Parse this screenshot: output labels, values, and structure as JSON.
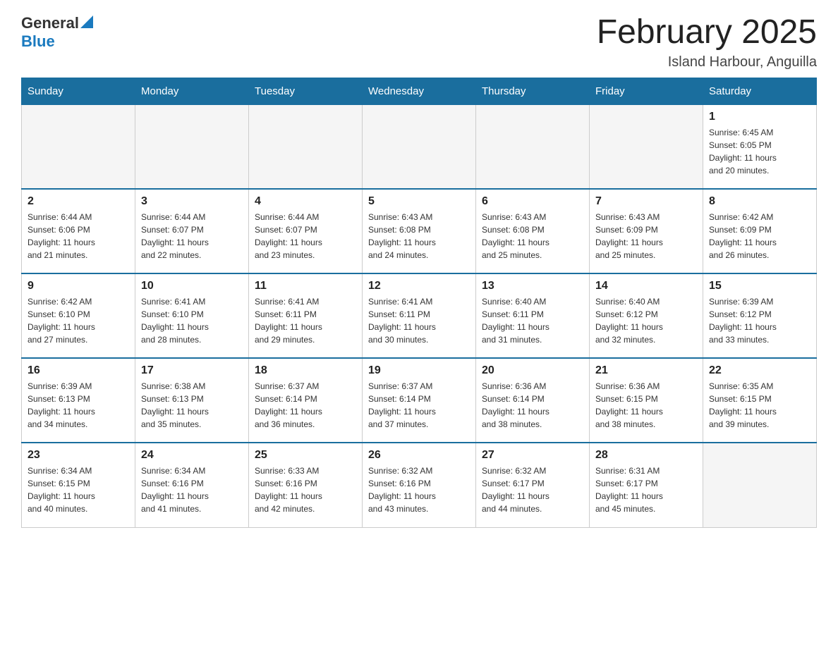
{
  "header": {
    "logo_general": "General",
    "logo_blue": "Blue",
    "month_title": "February 2025",
    "location": "Island Harbour, Anguilla"
  },
  "days_of_week": [
    "Sunday",
    "Monday",
    "Tuesday",
    "Wednesday",
    "Thursday",
    "Friday",
    "Saturday"
  ],
  "weeks": [
    [
      {
        "day": "",
        "info": ""
      },
      {
        "day": "",
        "info": ""
      },
      {
        "day": "",
        "info": ""
      },
      {
        "day": "",
        "info": ""
      },
      {
        "day": "",
        "info": ""
      },
      {
        "day": "",
        "info": ""
      },
      {
        "day": "1",
        "info": "Sunrise: 6:45 AM\nSunset: 6:05 PM\nDaylight: 11 hours\nand 20 minutes."
      }
    ],
    [
      {
        "day": "2",
        "info": "Sunrise: 6:44 AM\nSunset: 6:06 PM\nDaylight: 11 hours\nand 21 minutes."
      },
      {
        "day": "3",
        "info": "Sunrise: 6:44 AM\nSunset: 6:07 PM\nDaylight: 11 hours\nand 22 minutes."
      },
      {
        "day": "4",
        "info": "Sunrise: 6:44 AM\nSunset: 6:07 PM\nDaylight: 11 hours\nand 23 minutes."
      },
      {
        "day": "5",
        "info": "Sunrise: 6:43 AM\nSunset: 6:08 PM\nDaylight: 11 hours\nand 24 minutes."
      },
      {
        "day": "6",
        "info": "Sunrise: 6:43 AM\nSunset: 6:08 PM\nDaylight: 11 hours\nand 25 minutes."
      },
      {
        "day": "7",
        "info": "Sunrise: 6:43 AM\nSunset: 6:09 PM\nDaylight: 11 hours\nand 25 minutes."
      },
      {
        "day": "8",
        "info": "Sunrise: 6:42 AM\nSunset: 6:09 PM\nDaylight: 11 hours\nand 26 minutes."
      }
    ],
    [
      {
        "day": "9",
        "info": "Sunrise: 6:42 AM\nSunset: 6:10 PM\nDaylight: 11 hours\nand 27 minutes."
      },
      {
        "day": "10",
        "info": "Sunrise: 6:41 AM\nSunset: 6:10 PM\nDaylight: 11 hours\nand 28 minutes."
      },
      {
        "day": "11",
        "info": "Sunrise: 6:41 AM\nSunset: 6:11 PM\nDaylight: 11 hours\nand 29 minutes."
      },
      {
        "day": "12",
        "info": "Sunrise: 6:41 AM\nSunset: 6:11 PM\nDaylight: 11 hours\nand 30 minutes."
      },
      {
        "day": "13",
        "info": "Sunrise: 6:40 AM\nSunset: 6:11 PM\nDaylight: 11 hours\nand 31 minutes."
      },
      {
        "day": "14",
        "info": "Sunrise: 6:40 AM\nSunset: 6:12 PM\nDaylight: 11 hours\nand 32 minutes."
      },
      {
        "day": "15",
        "info": "Sunrise: 6:39 AM\nSunset: 6:12 PM\nDaylight: 11 hours\nand 33 minutes."
      }
    ],
    [
      {
        "day": "16",
        "info": "Sunrise: 6:39 AM\nSunset: 6:13 PM\nDaylight: 11 hours\nand 34 minutes."
      },
      {
        "day": "17",
        "info": "Sunrise: 6:38 AM\nSunset: 6:13 PM\nDaylight: 11 hours\nand 35 minutes."
      },
      {
        "day": "18",
        "info": "Sunrise: 6:37 AM\nSunset: 6:14 PM\nDaylight: 11 hours\nand 36 minutes."
      },
      {
        "day": "19",
        "info": "Sunrise: 6:37 AM\nSunset: 6:14 PM\nDaylight: 11 hours\nand 37 minutes."
      },
      {
        "day": "20",
        "info": "Sunrise: 6:36 AM\nSunset: 6:14 PM\nDaylight: 11 hours\nand 38 minutes."
      },
      {
        "day": "21",
        "info": "Sunrise: 6:36 AM\nSunset: 6:15 PM\nDaylight: 11 hours\nand 38 minutes."
      },
      {
        "day": "22",
        "info": "Sunrise: 6:35 AM\nSunset: 6:15 PM\nDaylight: 11 hours\nand 39 minutes."
      }
    ],
    [
      {
        "day": "23",
        "info": "Sunrise: 6:34 AM\nSunset: 6:15 PM\nDaylight: 11 hours\nand 40 minutes."
      },
      {
        "day": "24",
        "info": "Sunrise: 6:34 AM\nSunset: 6:16 PM\nDaylight: 11 hours\nand 41 minutes."
      },
      {
        "day": "25",
        "info": "Sunrise: 6:33 AM\nSunset: 6:16 PM\nDaylight: 11 hours\nand 42 minutes."
      },
      {
        "day": "26",
        "info": "Sunrise: 6:32 AM\nSunset: 6:16 PM\nDaylight: 11 hours\nand 43 minutes."
      },
      {
        "day": "27",
        "info": "Sunrise: 6:32 AM\nSunset: 6:17 PM\nDaylight: 11 hours\nand 44 minutes."
      },
      {
        "day": "28",
        "info": "Sunrise: 6:31 AM\nSunset: 6:17 PM\nDaylight: 11 hours\nand 45 minutes."
      },
      {
        "day": "",
        "info": ""
      }
    ]
  ]
}
